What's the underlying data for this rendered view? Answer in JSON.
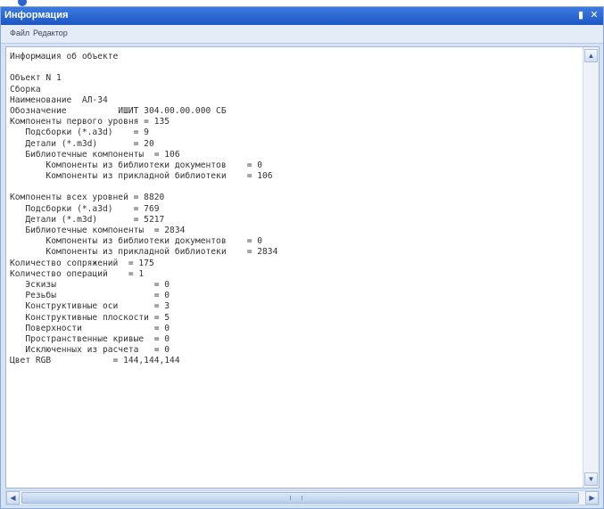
{
  "panel": {
    "title": "Информация",
    "pin_icon": "pin-icon",
    "close_icon": "close-icon"
  },
  "menu": {
    "items": [
      "Файл",
      "Редактор"
    ]
  },
  "content": {
    "lines": [
      "Информация об объекте",
      "",
      "Объект N 1",
      "Сборка",
      "Наименование  АЛ-34",
      "Обозначение          ИШИТ 304.00.00.000 СБ",
      "Компоненты первого уровня = 135",
      "   Подсборки (*.a3d)    = 9",
      "   Детали (*.m3d)       = 20",
      "   Библиотечные компоненты  = 106",
      "       Компоненты из библиотеки документов    = 0",
      "       Компоненты из прикладной библиотеки    = 106",
      "",
      "Компоненты всех уровней = 8820",
      "   Подсборки (*.a3d)    = 769",
      "   Детали (*.m3d)       = 5217",
      "   Библиотечные компоненты  = 2834",
      "       Компоненты из библиотеки документов    = 0",
      "       Компоненты из прикладной библиотеки    = 2834",
      "Количество сопряжений  = 175",
      "Количество операций    = 1",
      "   Эскизы                   = 0",
      "   Резьбы                   = 0",
      "   Конструктивные оси       = 3",
      "   Конструктивные плоскости = 5",
      "   Поверхности              = 0",
      "   Пространственные кривые  = 0",
      "   Исключенных из расчета   = 0",
      "Цвет RGB            = 144,144,144"
    ]
  },
  "scrollbars": {
    "up_icon": "scroll-up-arrow-icon",
    "down_icon": "scroll-down-arrow-icon",
    "left_icon": "scroll-left-arrow-icon",
    "right_icon": "scroll-right-arrow-icon"
  }
}
